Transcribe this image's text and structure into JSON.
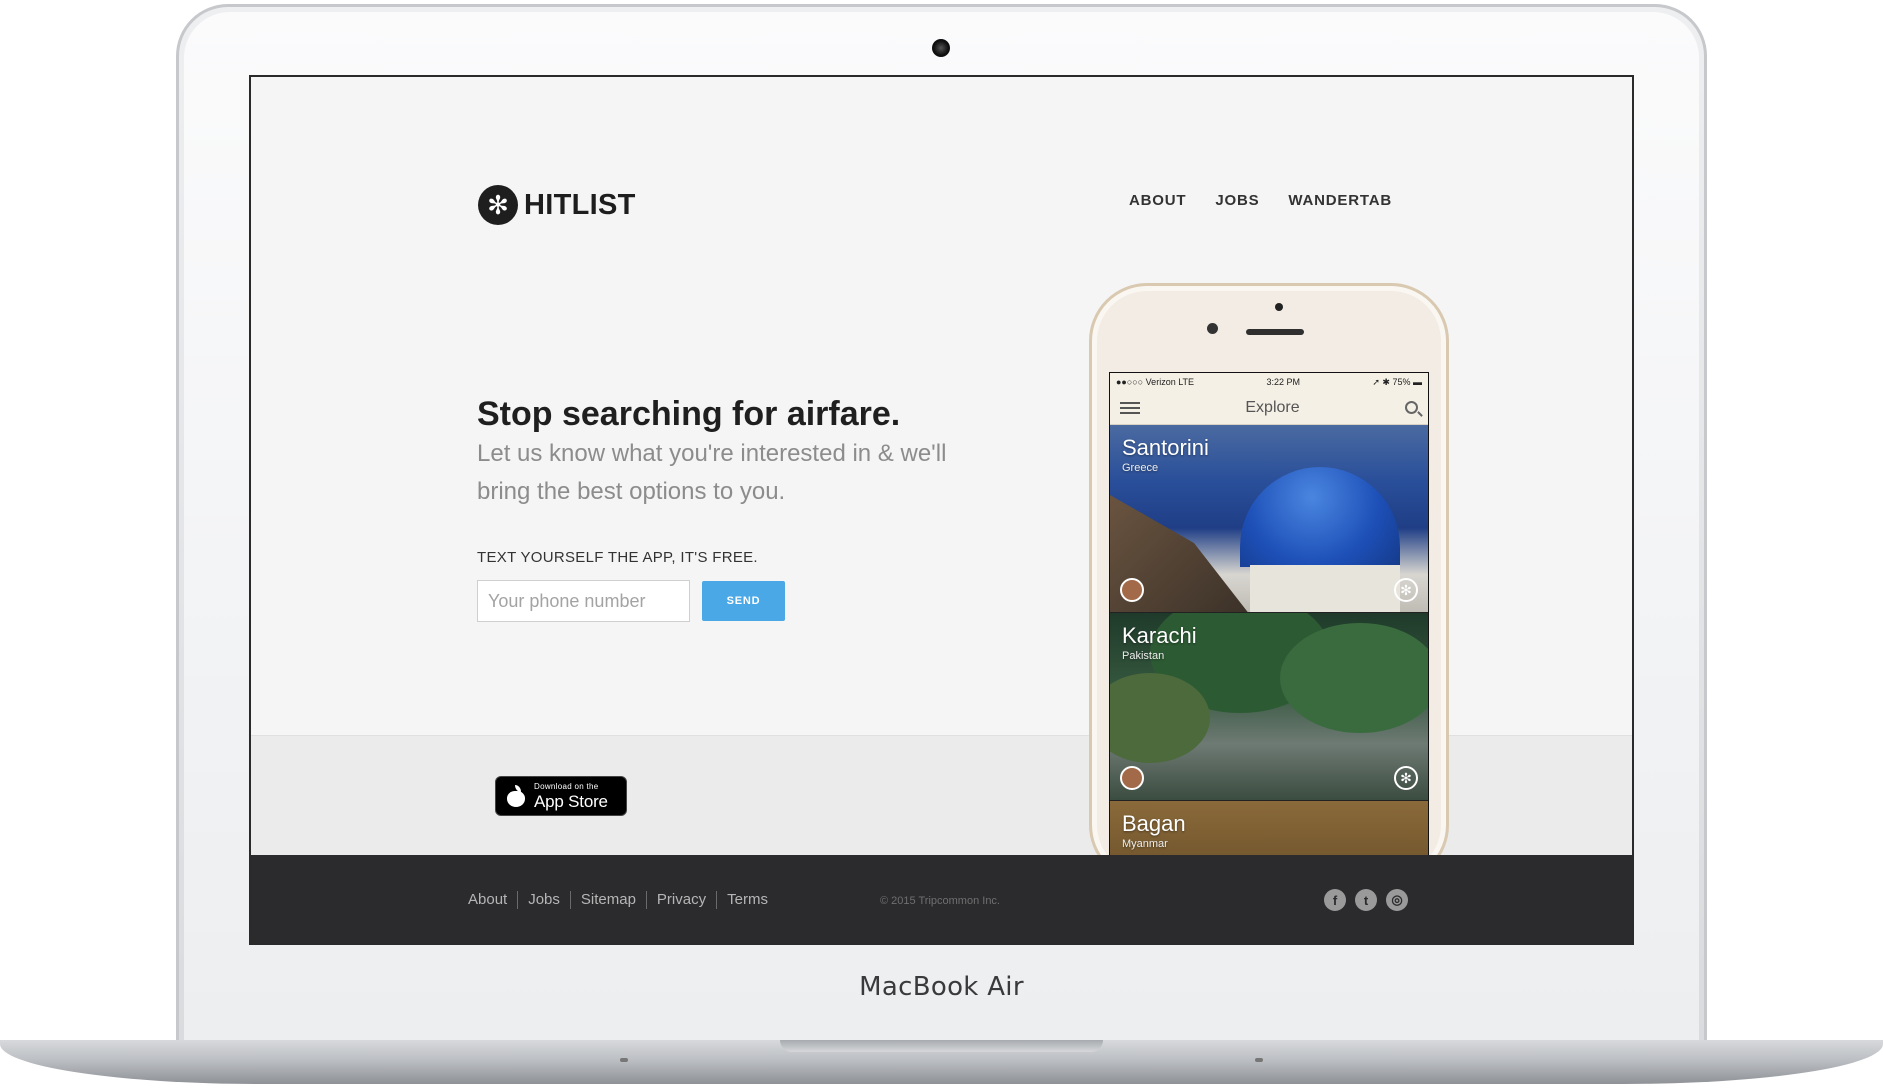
{
  "device": {
    "model_label": "MacBook Air"
  },
  "header": {
    "logo_text": "HITLIST",
    "logo_icon": "snowflake-icon",
    "nav": [
      "ABOUT",
      "JOBS",
      "WANDERTAB"
    ]
  },
  "hero": {
    "headline": "Stop searching for airfare.",
    "subline": "Let us know what you're interested in & we'll bring the best options to you.",
    "cta_label": "TEXT YOURSELF THE APP, IT'S FREE.",
    "phone_placeholder": "Your phone number",
    "send_label": "SEND"
  },
  "appstore": {
    "small": "Download on the",
    "big": "App Store",
    "icon": "apple-icon"
  },
  "footer": {
    "links": [
      "About",
      "Jobs",
      "Sitemap",
      "Privacy",
      "Terms"
    ],
    "copyright": "© 2015 Tripcommon Inc.",
    "social": [
      "facebook-icon",
      "twitter-icon",
      "instagram-icon"
    ]
  },
  "phone": {
    "status_left": "●●○○○ Verizon  LTE",
    "status_time": "3:22 PM",
    "status_right": "➚ ✱ 75% ▬",
    "app_title": "Explore",
    "cards": [
      {
        "city": "Santorini",
        "country": "Greece"
      },
      {
        "city": "Karachi",
        "country": "Pakistan"
      },
      {
        "city": "Bagan",
        "country": "Myanmar"
      }
    ]
  },
  "colors": {
    "accent": "#4aa8e6",
    "footer_bg": "#2b2b2e",
    "page_bg": "#f5f5f5"
  }
}
